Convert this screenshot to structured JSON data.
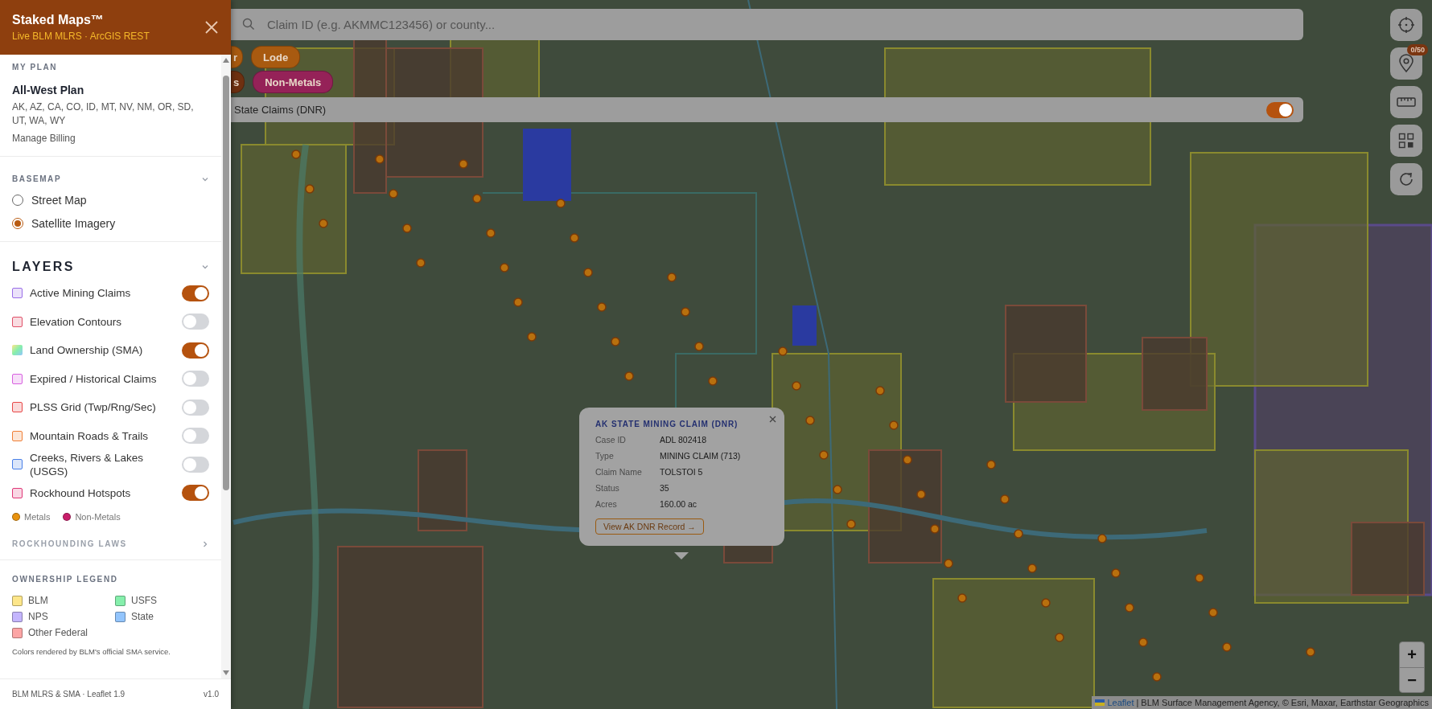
{
  "sidebar": {
    "title": "Staked Maps™",
    "subtitle": "Live BLM MLRS · ArcGIS REST",
    "my_plan": {
      "heading": "MY PLAN",
      "plan_name": "All-West Plan",
      "states": "AK, AZ, CA, CO, ID, MT, NV, NM, OR, SD, UT, WA, WY",
      "manage_link": "Manage Billing"
    },
    "basemap": {
      "heading": "BASEMAP",
      "expanded": true,
      "options": [
        {
          "label": "Street Map",
          "selected": false
        },
        {
          "label": "Satellite Imagery",
          "selected": true
        }
      ]
    },
    "layers": {
      "heading": "LAYERS",
      "expanded": true,
      "items": [
        {
          "label": "Active Mining Claims",
          "kind": "swatch",
          "color": "#9a6ee8",
          "on": true
        },
        {
          "label": "Elevation Contours",
          "kind": "swatch",
          "color": "#e05068",
          "on": false
        },
        {
          "label": "Land Ownership (SMA)",
          "kind": "gradient",
          "on": true
        },
        {
          "label": "Expired / Historical Claims",
          "kind": "swatch",
          "color": "#d860e0",
          "on": false
        },
        {
          "label": "PLSS Grid (Twp/Rng/Sec)",
          "kind": "swatch",
          "color": "#e84848",
          "on": false
        },
        {
          "label": "Mountain Roads & Trails",
          "kind": "swatch",
          "color": "#f08038",
          "on": false
        },
        {
          "label": "Creeks, Rivers & Lakes (USGS)",
          "kind": "swatch",
          "color": "#4a80e8",
          "on": false
        },
        {
          "label": "Rockhound Hotspots",
          "kind": "swatch",
          "color": "#e03878",
          "on": true
        }
      ],
      "legend": [
        {
          "label": "Metals",
          "color": "#e8920f"
        },
        {
          "label": "Non-Metals",
          "color": "#c81e6a"
        }
      ]
    },
    "rockhounding_laws": {
      "label": "ROCKHOUNDING LAWS",
      "expanded": false
    },
    "ownership_legend": {
      "heading": "OWNERSHIP LEGEND",
      "items": [
        {
          "label": "BLM",
          "color": "#fde68a"
        },
        {
          "label": "USFS",
          "color": "#86efac"
        },
        {
          "label": "NPS",
          "color": "#c4b5fd"
        },
        {
          "label": "State",
          "color": "#93c5fd"
        },
        {
          "label": "Other Federal",
          "color": "#fca5a5"
        }
      ],
      "note": "Colors rendered by BLM's official SMA service."
    },
    "footer": {
      "credits": "BLM MLRS & SMA · Leaflet 1.9",
      "version": "v1.0"
    }
  },
  "map": {
    "search": {
      "placeholder": "Claim ID (e.g. AKMMC123456) or county..."
    },
    "chip_rows": [
      [
        {
          "label": "r",
          "color": "#a85a10"
        },
        {
          "label": "Lode",
          "color": "#a85a10"
        }
      ],
      [
        {
          "label": "s",
          "color": "#6e3010"
        },
        {
          "label": "Non-Metals",
          "color": "#952258"
        }
      ]
    ],
    "layer_bar": {
      "label": "State Claims (DNR)",
      "on": true
    },
    "popup": {
      "title": "AK STATE MINING CLAIM (DNR)",
      "rows": [
        {
          "label": "Case ID",
          "value": "ADL 802418"
        },
        {
          "label": "Type",
          "value": "MINING CLAIM (713)"
        },
        {
          "label": "Claim Name",
          "value": "TOLSTOI 5"
        },
        {
          "label": "Status",
          "value": "35"
        },
        {
          "label": "Acres",
          "value": "160.00 ac"
        }
      ],
      "button": "View AK DNR Record →"
    },
    "tools": [
      {
        "kind": "locate"
      },
      {
        "kind": "pin",
        "badge": "0/50"
      },
      {
        "kind": "ruler"
      },
      {
        "kind": "grid"
      },
      {
        "kind": "refresh"
      }
    ],
    "zoom": {
      "in": "+",
      "out": "−"
    },
    "attribution": {
      "link": "Leaflet",
      "text": "| BLM Surface Management Agency, © Esri, Maxar, Earthstar Geographics"
    }
  }
}
